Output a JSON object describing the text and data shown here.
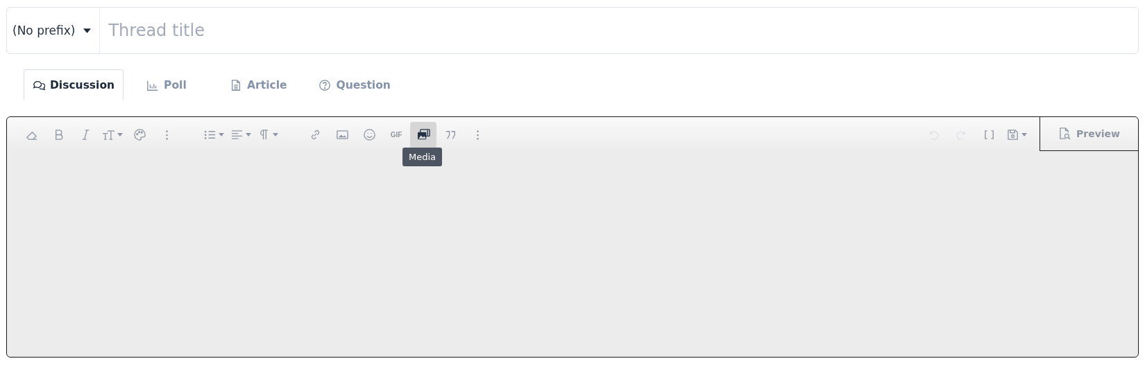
{
  "title_bar": {
    "prefix": "(No prefix)",
    "placeholder": "Thread title"
  },
  "tabs": [
    {
      "label": "Discussion",
      "kind": "discussion",
      "selected": true
    },
    {
      "label": "Poll",
      "kind": "poll",
      "selected": false
    },
    {
      "label": "Article",
      "kind": "article",
      "selected": false
    },
    {
      "label": "Question",
      "kind": "question",
      "selected": false
    }
  ],
  "toolbar": {
    "groups": [
      [
        {
          "kind": "eraser",
          "dropdown": false,
          "disabled": false,
          "active": false
        },
        {
          "kind": "bold",
          "dropdown": false,
          "disabled": false,
          "active": false
        },
        {
          "kind": "italic",
          "dropdown": false,
          "disabled": false,
          "active": false
        },
        {
          "kind": "textsize",
          "dropdown": true,
          "disabled": false,
          "active": false
        },
        {
          "kind": "palette",
          "dropdown": false,
          "disabled": false,
          "active": false
        },
        {
          "kind": "more",
          "dropdown": false,
          "disabled": false,
          "active": false
        }
      ],
      [
        {
          "kind": "list",
          "dropdown": true,
          "disabled": false,
          "active": false
        },
        {
          "kind": "align",
          "dropdown": true,
          "disabled": false,
          "active": false
        },
        {
          "kind": "paragraph",
          "dropdown": true,
          "disabled": false,
          "active": false
        }
      ],
      [
        {
          "kind": "link",
          "dropdown": false,
          "disabled": false,
          "active": false
        },
        {
          "kind": "image",
          "dropdown": false,
          "disabled": false,
          "active": false
        },
        {
          "kind": "emoji",
          "dropdown": false,
          "disabled": false,
          "active": false
        },
        {
          "kind": "gif",
          "label": "GIF",
          "dropdown": false,
          "disabled": false,
          "active": false
        },
        {
          "kind": "media",
          "dropdown": false,
          "disabled": false,
          "active": true,
          "tooltip": "Media"
        },
        {
          "kind": "quote",
          "dropdown": false,
          "disabled": false,
          "active": false
        },
        {
          "kind": "more",
          "dropdown": false,
          "disabled": false,
          "active": false
        }
      ]
    ],
    "right": [
      {
        "kind": "undo",
        "dropdown": false,
        "disabled": true,
        "active": false
      },
      {
        "kind": "redo",
        "dropdown": false,
        "disabled": true,
        "active": false
      },
      {
        "kind": "brackets",
        "dropdown": false,
        "disabled": false,
        "active": false
      },
      {
        "kind": "save",
        "dropdown": true,
        "disabled": false,
        "active": false
      }
    ],
    "preview": "Preview"
  }
}
